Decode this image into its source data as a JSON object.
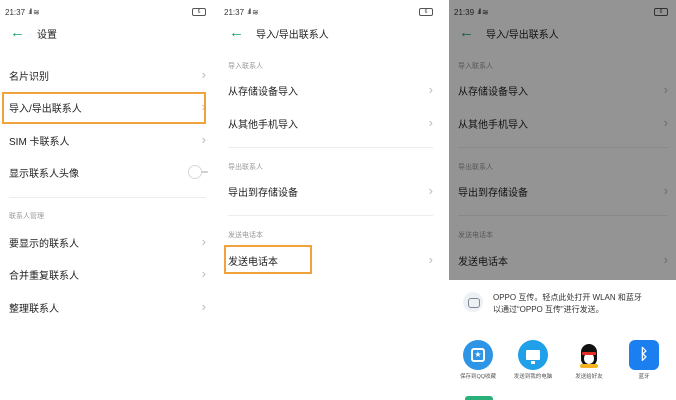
{
  "settings_screen": {
    "status": {
      "time": "21:37",
      "battery": "6"
    },
    "title": "设置",
    "rows": [
      {
        "label": "名片识别"
      },
      {
        "label": "导入/导出联系人"
      },
      {
        "label": "SIM 卡联系人"
      },
      {
        "label": "显示联系人头像"
      }
    ],
    "section_label": "联系人管理",
    "manage_rows": [
      {
        "label": "要显示的联系人"
      },
      {
        "label": "合并重复联系人"
      },
      {
        "label": "整理联系人"
      }
    ]
  },
  "import_export_screen": {
    "status": {
      "time": "21:37",
      "battery": "6"
    },
    "title": "导入/导出联系人",
    "import_section": "导入联系人",
    "import_rows": [
      {
        "label": "从存储设备导入"
      },
      {
        "label": "从其他手机导入"
      }
    ],
    "export_section": "导出联系人",
    "export_rows": [
      {
        "label": "导出到存储设备"
      }
    ],
    "send_section": "发送电话本",
    "send_rows": [
      {
        "label": "发送电话本"
      }
    ]
  },
  "share_screen": {
    "status": {
      "time": "21:39",
      "battery": "6"
    },
    "title": "导入/导出联系人",
    "import_section": "导入联系人",
    "import_rows": [
      {
        "label": "从存储设备导入"
      },
      {
        "label": "从其他手机导入"
      }
    ],
    "export_section": "导出联系人",
    "export_rows": [
      {
        "label": "导出到存储设备"
      }
    ],
    "send_section": "发送电话本",
    "send_rows": [
      {
        "label": "发送电话本"
      }
    ],
    "share_sheet": {
      "line1": "OPPO 互传。轻点此处打开 WLAN 和蓝牙",
      "line2": "以通过“OPPO 互传”进行发送。",
      "apps": [
        {
          "label": "保存到QQ收藏",
          "icon": "qq-favorites-icon"
        },
        {
          "label": "发送到我的电脑",
          "icon": "computer-icon"
        },
        {
          "label": "发送给好友",
          "icon": "qq-penguin-icon"
        },
        {
          "label": "蓝牙",
          "icon": "bluetooth-icon"
        }
      ]
    }
  },
  "colors": {
    "accent": "#1aa260",
    "highlight": "#f0a33a",
    "bluetooth": "#1c7ff0"
  }
}
